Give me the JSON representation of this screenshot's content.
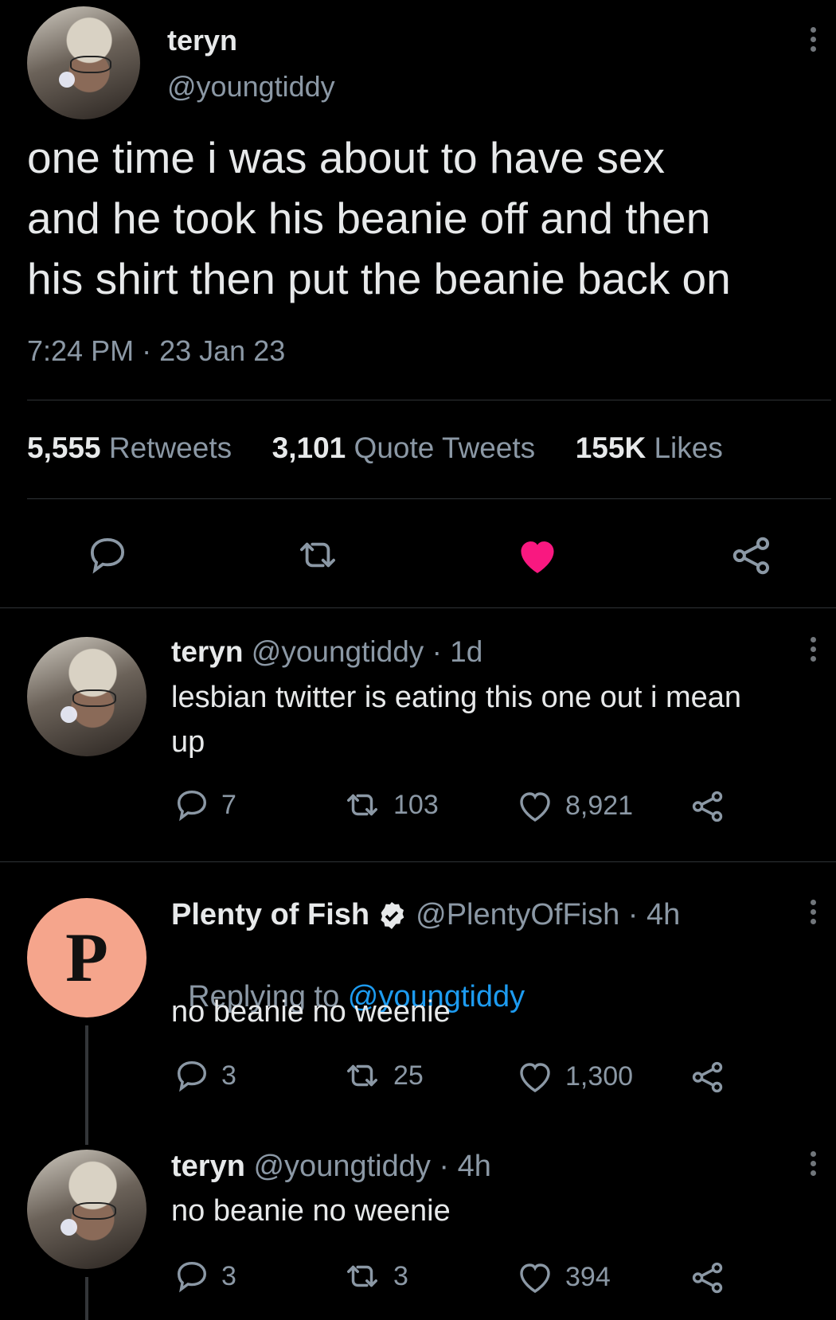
{
  "main_tweet": {
    "name": "teryn",
    "handle": "@youngtiddy",
    "text_lines": [
      "one time i was about to have sex",
      "and he took his beanie off and then",
      "his shirt then put the beanie back on"
    ],
    "time": "7:24 PM",
    "sep": "·",
    "date": "23 Jan 23",
    "stats": {
      "retweets_count": "5,555",
      "retweets_label": "Retweets",
      "quotes_count": "3,101",
      "quotes_label": "Quote Tweets",
      "likes_count": "155K",
      "likes_label": "Likes"
    }
  },
  "replies": [
    {
      "name": "teryn",
      "handle": "@youngtiddy",
      "meta": " · 1d",
      "text_lines": [
        "lesbian twitter is eating this one out i mean",
        "up"
      ],
      "counts": {
        "replies": "7",
        "retweets": "103",
        "likes": "8,921"
      }
    },
    {
      "name": "Plenty of Fish",
      "avatar_letter": "P",
      "handle": "@PlentyOfFish",
      "meta": " · 4h",
      "replying_prefix": "Replying to ",
      "replying_handle": "@youngtiddy",
      "text_lines": [
        "no beanie no weenie"
      ],
      "counts": {
        "replies": "3",
        "retweets": "25",
        "likes": "1,300"
      }
    },
    {
      "name": "teryn",
      "handle": "@youngtiddy",
      "meta": " · 4h",
      "text_lines": [
        "no beanie no weenie"
      ],
      "counts": {
        "replies": "3",
        "retweets": "3",
        "likes": "394"
      }
    }
  ],
  "colors": {
    "like_active": "#f91880",
    "link": "#1d9bf0",
    "verified": "#e7e9ea",
    "muted": "#8b98a5"
  },
  "icons": [
    "reply-icon",
    "retweet-icon",
    "heart-icon",
    "share-icon",
    "more-icon",
    "verified-badge-icon"
  ]
}
